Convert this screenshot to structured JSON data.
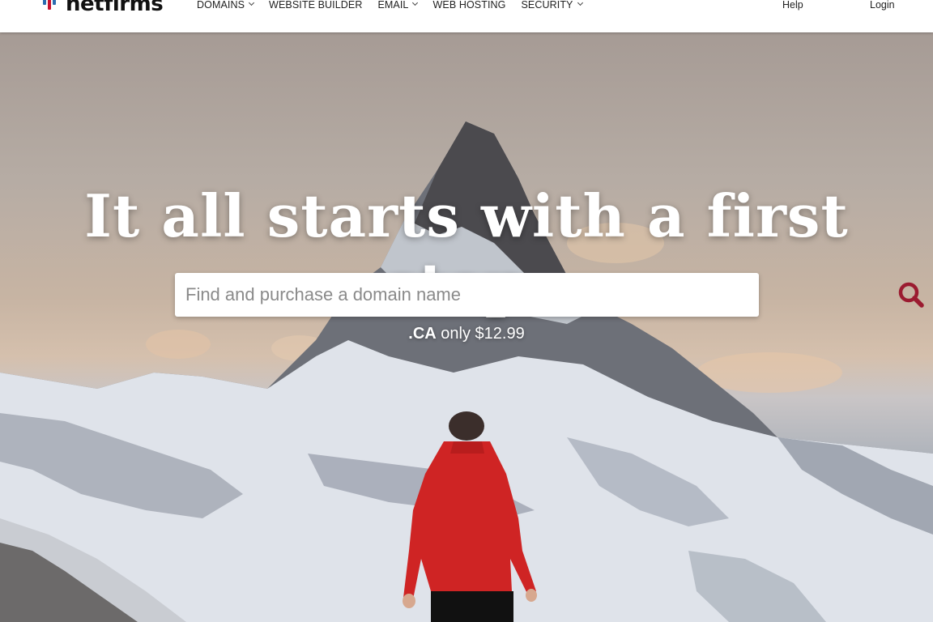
{
  "brand": {
    "name": "netfirms",
    "colors": {
      "red": "#c8102e",
      "blue": "#2b6cb0",
      "search_icon": "#9b1b30"
    }
  },
  "nav": {
    "items": [
      {
        "label": "DOMAINS",
        "has_dropdown": true
      },
      {
        "label": "WEBSITE BUILDER",
        "has_dropdown": false
      },
      {
        "label": "EMAIL",
        "has_dropdown": true
      },
      {
        "label": "WEB HOSTING",
        "has_dropdown": false
      },
      {
        "label": "SECURITY",
        "has_dropdown": true
      }
    ],
    "help_label": "Help",
    "login_label": "Login"
  },
  "hero": {
    "headline": "It all starts with a first step.",
    "search": {
      "placeholder": "Find and purchase a domain name",
      "icon": "search-icon"
    },
    "promo": {
      "tld": ".CA",
      "text": " only $12.99"
    }
  }
}
